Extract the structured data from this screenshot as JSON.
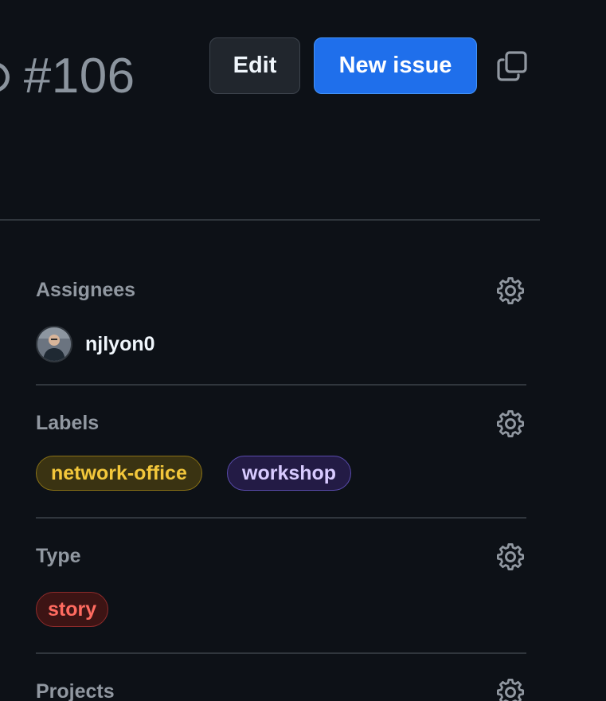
{
  "header": {
    "issue_number": "#106",
    "edit_label": "Edit",
    "new_issue_label": "New issue",
    "copy_icon": "copy-icon"
  },
  "sidebar": {
    "assignees": {
      "title": "Assignees",
      "icon": "gear-icon",
      "users": [
        {
          "login": "njlyon0"
        }
      ]
    },
    "labels": {
      "title": "Labels",
      "icon": "gear-icon",
      "items": [
        {
          "name": "network-office",
          "color": "#f3c73b"
        },
        {
          "name": "workshop",
          "color": "#d8cbff"
        }
      ]
    },
    "type": {
      "title": "Type",
      "icon": "gear-icon",
      "value": "story",
      "color": "#ff6b60"
    },
    "projects": {
      "title": "Projects",
      "icon": "gear-icon"
    }
  },
  "colors": {
    "background": "#0d1117",
    "primary_button": "#1f6feb",
    "border": "#30363d",
    "muted_text": "#9198a1"
  }
}
